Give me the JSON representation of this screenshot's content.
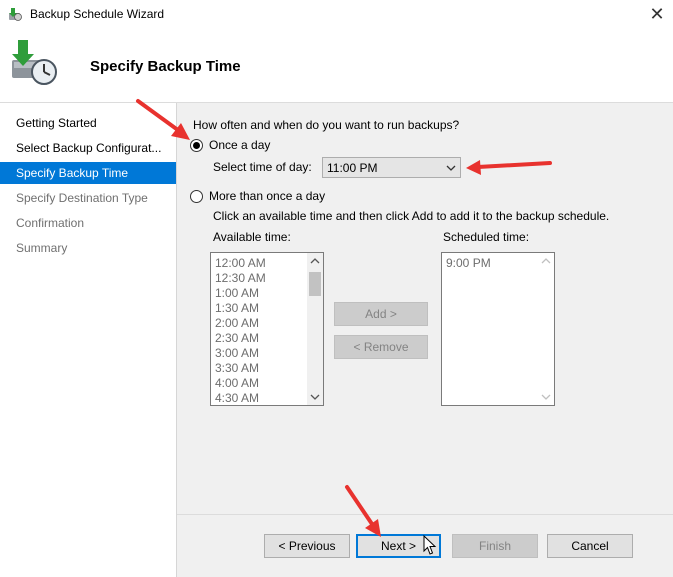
{
  "window": {
    "title": "Backup Schedule Wizard",
    "close_glyph": "✕"
  },
  "header": {
    "title": "Specify Backup Time"
  },
  "nav": {
    "items": [
      {
        "label": "Getting Started",
        "state": "done"
      },
      {
        "label": "Select Backup Configurat...",
        "state": "done"
      },
      {
        "label": "Specify Backup Time",
        "state": "active"
      },
      {
        "label": "Specify Destination Type",
        "state": "future"
      },
      {
        "label": "Confirmation",
        "state": "future"
      },
      {
        "label": "Summary",
        "state": "future"
      }
    ]
  },
  "content": {
    "question": "How often and when do you want to run backups?",
    "once_label": "Once a day",
    "time_of_day_label": "Select time of day:",
    "time_of_day_value": "11:00 PM",
    "more_label": "More than once a day",
    "instruction": "Click an available time and then click Add to add it to the backup schedule.",
    "available_label": "Available time:",
    "scheduled_label": "Scheduled time:",
    "available_times": [
      "12:00 AM",
      "12:30 AM",
      "1:00 AM",
      "1:30 AM",
      "2:00 AM",
      "2:30 AM",
      "3:00 AM",
      "3:30 AM",
      "4:00 AM",
      "4:30 AM"
    ],
    "scheduled_times": [
      "9:00 PM"
    ],
    "add_label": "Add >",
    "remove_label": "< Remove"
  },
  "footer": {
    "previous_label": "< Previous",
    "next_label": "Next >",
    "finish_label": "Finish",
    "cancel_label": "Cancel"
  },
  "colors": {
    "accent": "#0078d7",
    "annotation_arrow": "#e8322e"
  }
}
